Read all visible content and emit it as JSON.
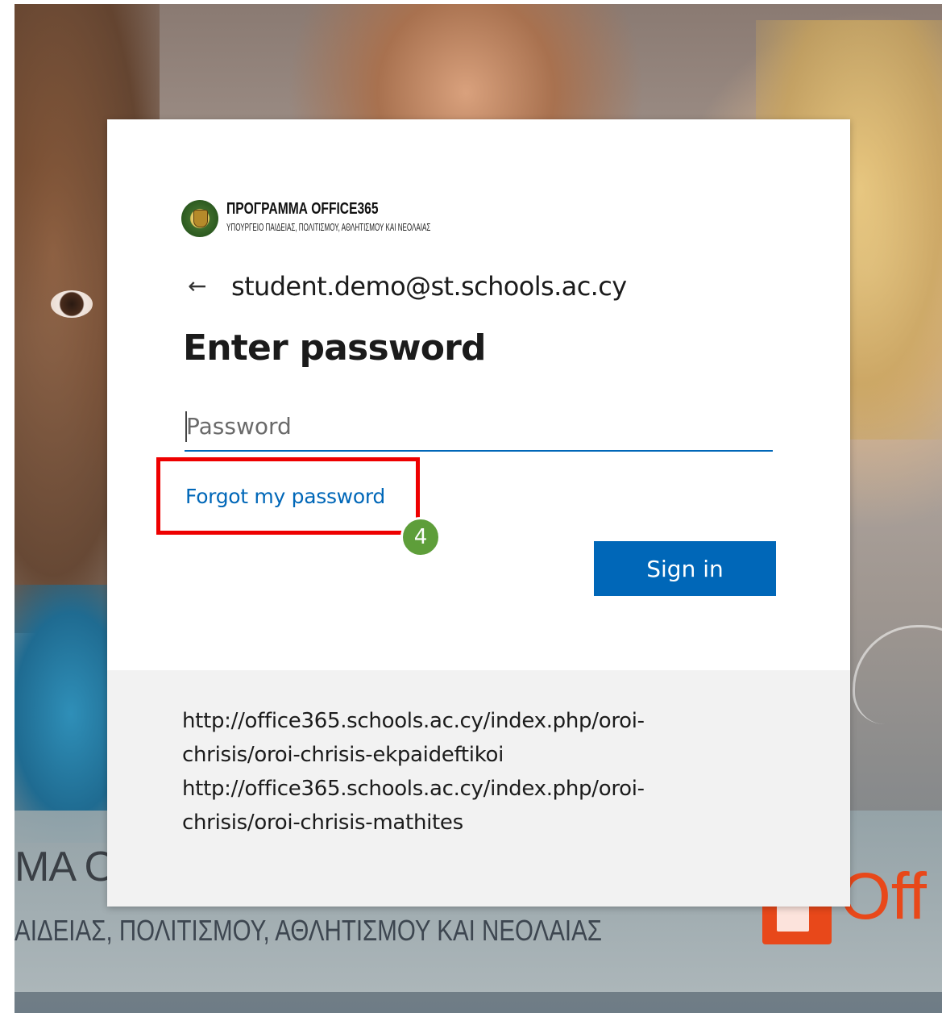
{
  "background": {
    "banner_title": "ΜΑ Ο",
    "banner_subtitle": "ΑΙΔΕΙΑΣ, ΠΟΛΙΤΙΣΜΟΥ, ΑΘΛΗΤΙΣΜΟΥ ΚΑΙ ΝΕΟΛΑΙΑΣ",
    "office_brand": "Off",
    "office_color": "#e8481a"
  },
  "logo": {
    "title": "ΠΡΟΓΡΑΜΜΑ OFFICE365",
    "subtitle": "ΥΠΟΥΡΓΕΙΟ ΠΑΙΔΕΙΑΣ, ΠΟΛΙΤΙΣΜΟΥ, ΑΘΛΗΤΙΣΜΟΥ ΚΑΙ ΝΕΟΛΑΙΑΣ",
    "icon": "government-seal-icon"
  },
  "identity": {
    "back_icon": "←",
    "email": "student.demo@st.schools.ac.cy"
  },
  "heading": "Enter password",
  "password": {
    "placeholder": "Password",
    "value": ""
  },
  "forgot_link": "Forgot my password",
  "annotation": {
    "step_number": "4",
    "highlight_color": "#ee0000",
    "badge_color": "#5e9e3a"
  },
  "signin_button": "Sign in",
  "footer": {
    "lines": [
      "http://office365.schools.ac.cy/index.php/oroi-",
      "chrisis/oroi-chrisis-ekpaideftikoi",
      "http://office365.schools.ac.cy/index.php/oroi-",
      "chrisis/oroi-chrisis-mathites"
    ]
  },
  "colors": {
    "accent": "#0067b8",
    "footer_bg": "#f2f2f2"
  }
}
